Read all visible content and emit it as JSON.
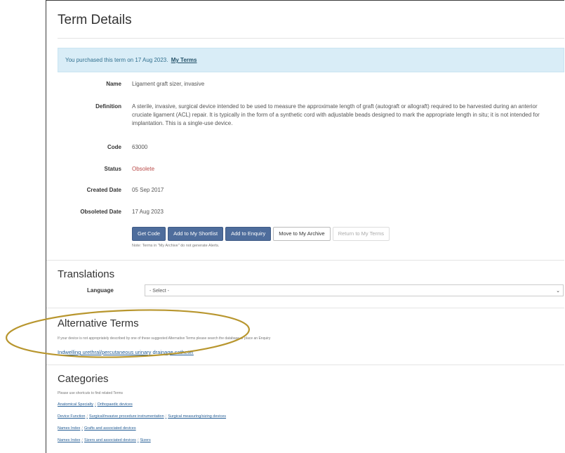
{
  "page_title": "Term Details",
  "alert": {
    "text": "You purchased this term on 17 Aug 2023.",
    "link": "My Terms"
  },
  "fields": {
    "name_label": "Name",
    "name_value": "Ligament graft sizer, invasive",
    "definition_label": "Definition",
    "definition_value": "A sterile, invasive, surgical device intended to be used to measure the approximate length of graft (autograft or allograft) required to be harvested during an anterior cruciate ligament (ACL) repair. It is typically in the form of a synthetic cord with adjustable beads designed to mark the appropriate length in situ; it is not intended for implantation. This is a single-use device.",
    "code_label": "Code",
    "code_value": "63000",
    "status_label": "Status",
    "status_value": "Obsolete",
    "created_label": "Created Date",
    "created_value": "05 Sep 2017",
    "obsoleted_label": "Obsoleted Date",
    "obsoleted_value": "17 Aug 2023"
  },
  "buttons": {
    "get_code": "Get Code",
    "add_shortlist": "Add to My Shortlist",
    "add_enquiry": "Add to Enquiry",
    "move_archive": "Move to My Archive",
    "return_terms": "Return to My Terms"
  },
  "archive_note": "Note: Terms in \"My Archive\" do not generate Alerts.",
  "translations": {
    "heading": "Translations",
    "language_label": "Language",
    "select_value": "- Select -"
  },
  "alternative": {
    "heading": "Alternative Terms",
    "note": "If your device is not appropriately described by one of these suggested Alternative Terms please search the database or place an Enquiry",
    "term": "Indwelling urethral/percutaneous urinary drainage catheter"
  },
  "categories": {
    "heading": "Categories",
    "note": "Please use shortcuts to find related Terms",
    "rows": [
      [
        "Anatomical Specialty",
        "Orthopaedic devices"
      ],
      [
        "Device Function",
        "Surgical/invasive procedure instrumentation",
        "Surgical measuring/sizing devices"
      ],
      [
        "Names Index",
        "Grafts and associated devices"
      ],
      [
        "Names Index",
        "Sizers and associated devices",
        "Sizers"
      ]
    ]
  },
  "colors": {
    "primary_button": "#4e6d9c",
    "alert_bg": "#d9edf7",
    "status": "#b94a48",
    "highlight_ellipse": "#b8962e"
  }
}
